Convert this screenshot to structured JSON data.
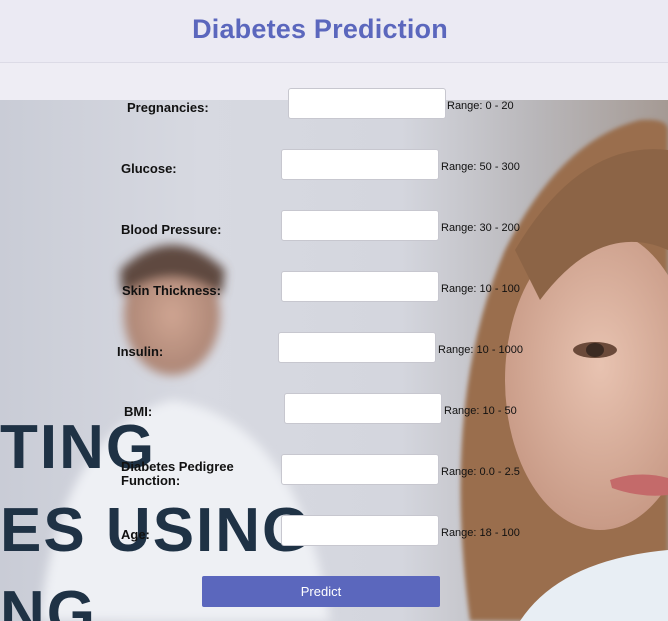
{
  "header": {
    "title": "Diabetes Prediction"
  },
  "background": {
    "lines": [
      "TING",
      "ES USING",
      "NG"
    ]
  },
  "form": {
    "fields": [
      {
        "label": "Pregnancies:",
        "range": "Range: 0 - 20",
        "value": "",
        "placeholder": ""
      },
      {
        "label": "Glucose:",
        "range": "Range: 50 - 300",
        "value": "",
        "placeholder": ""
      },
      {
        "label": "Blood Pressure:",
        "range": "Range: 30 - 200",
        "value": "",
        "placeholder": ""
      },
      {
        "label": "Skin Thickness:",
        "range": "Range: 10 - 100",
        "value": "",
        "placeholder": ""
      },
      {
        "label": "Insulin:",
        "range": "Range: 10 - 1000",
        "value": "",
        "placeholder": ""
      },
      {
        "label": "BMI:",
        "range": "Range: 10 - 50",
        "value": "",
        "placeholder": ""
      },
      {
        "label": "Diabetes Pedigree Function:",
        "range": "Range: 0.0 - 2.5",
        "value": "",
        "placeholder": ""
      },
      {
        "label": "Age:",
        "range": "Range: 18 - 100",
        "value": "",
        "placeholder": ""
      }
    ],
    "submit_label": "Predict"
  },
  "colors": {
    "accent": "#5b67bd",
    "header_bg": "#ebeaf3"
  }
}
